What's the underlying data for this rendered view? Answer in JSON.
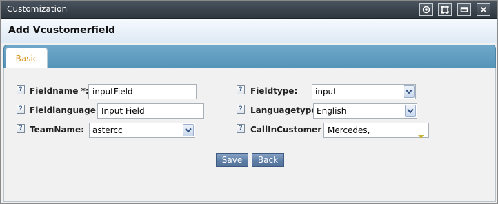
{
  "window": {
    "title": "Customization",
    "buttons": [
      {
        "name": "restore-icon"
      },
      {
        "name": "maximize-icon"
      },
      {
        "name": "minimize-icon"
      },
      {
        "name": "close-icon"
      }
    ]
  },
  "header": {
    "title": "Add Vcustomerfield"
  },
  "tabs": [
    {
      "label": "Basic",
      "active": true
    }
  ],
  "form": {
    "fieldname": {
      "label": "Fieldname *:",
      "value": "inputField"
    },
    "fieldlanguage": {
      "label": "Fieldlanguage *:",
      "value": "Input Field"
    },
    "teamname": {
      "label": "TeamName:",
      "value": "astercc"
    },
    "fieldtype": {
      "label": "Fieldtype:",
      "value": "input"
    },
    "languagetype": {
      "label": "Languagetype:",
      "value": "English"
    },
    "callincustomer": {
      "label": "CallInCustomer *:",
      "value": "Mercedes,"
    },
    "help_glyph": "?"
  },
  "actions": {
    "save": "Save",
    "back": "Back"
  },
  "colors": {
    "accent_tab_text": "#d89a2a",
    "tabstrip": "#5a98bb",
    "button": "#5f7fa8"
  }
}
